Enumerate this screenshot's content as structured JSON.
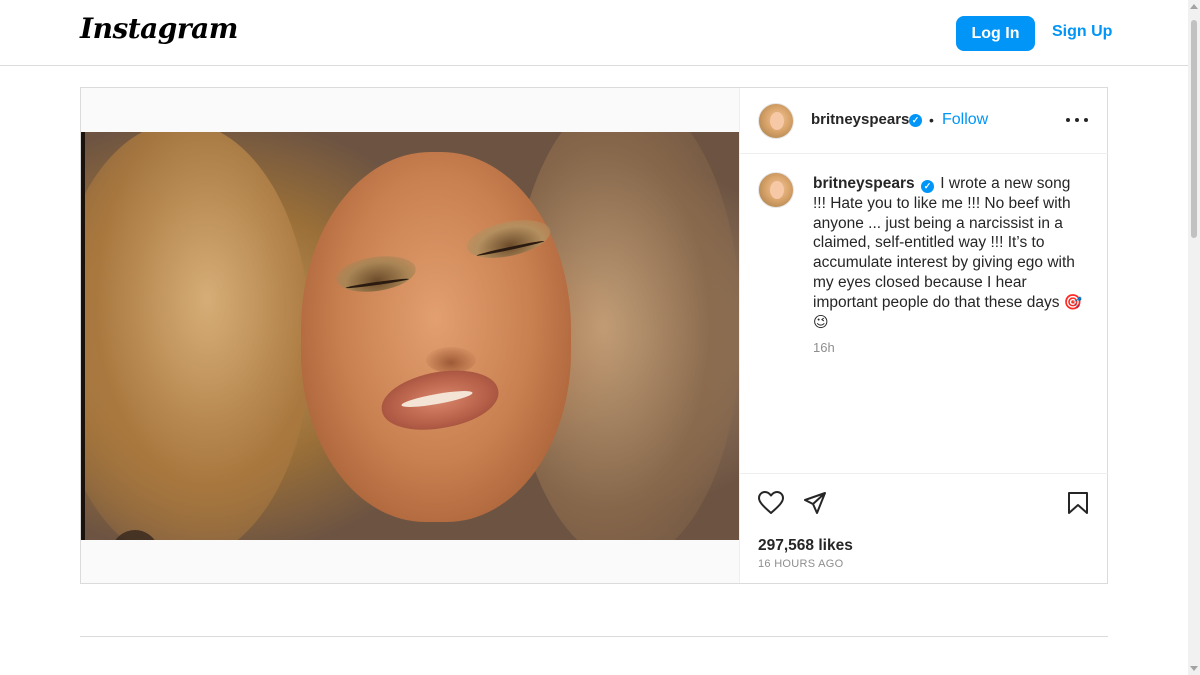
{
  "header": {
    "logo_text": "Instagram",
    "login_label": "Log In",
    "signup_label": "Sign Up"
  },
  "post": {
    "username": "britneyspears",
    "follow_label": "Follow",
    "separator": "•",
    "caption": "I wrote a new song !!! Hate you to like me !!! No beef with anyone ... just being a narcissist in a claimed, self-entitled way !!! It’s to accumulate interest by giving ego with my eyes closed because I hear important people do that these days",
    "caption_emojis": "🎯😉",
    "caption_time": "16h",
    "likes": "297,568 likes",
    "posted_ago": "16 HOURS AGO"
  },
  "icons": {
    "verified": "verified-badge-icon",
    "like": "heart-icon",
    "share": "send-icon",
    "save": "bookmark-icon",
    "more": "more-options-icon"
  },
  "colors": {
    "accent": "#0095f6",
    "text": "#262626",
    "muted": "#8e8e8e",
    "border": "#dbdbdb"
  }
}
